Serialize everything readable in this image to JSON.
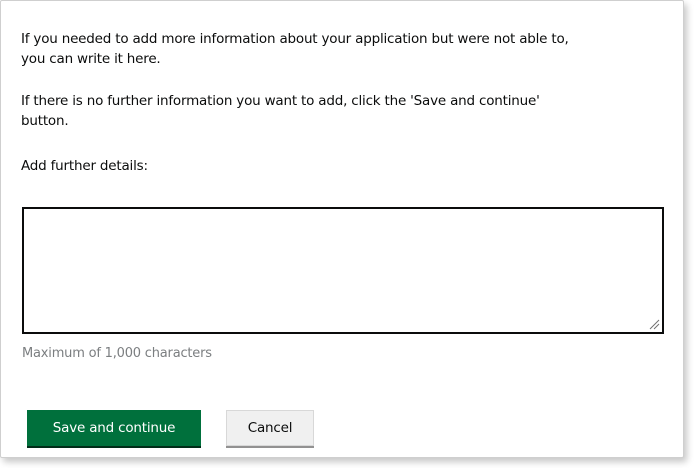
{
  "intro": {
    "line1": "If you needed to add more information about your application but were not able to,",
    "line2": "you can write it here.",
    "line3": "If there is no further information you want to add, click the 'Save and continue'",
    "line4": "button."
  },
  "form": {
    "label": "Add further details:",
    "textarea_value": "",
    "hint": "Maximum of 1,000 characters"
  },
  "actions": {
    "primary_label": "Save and continue",
    "secondary_label": "Cancel"
  },
  "colors": {
    "primary_button": "#00703c",
    "secondary_button": "#f0f0f0",
    "hint_text": "#7b7e80"
  }
}
